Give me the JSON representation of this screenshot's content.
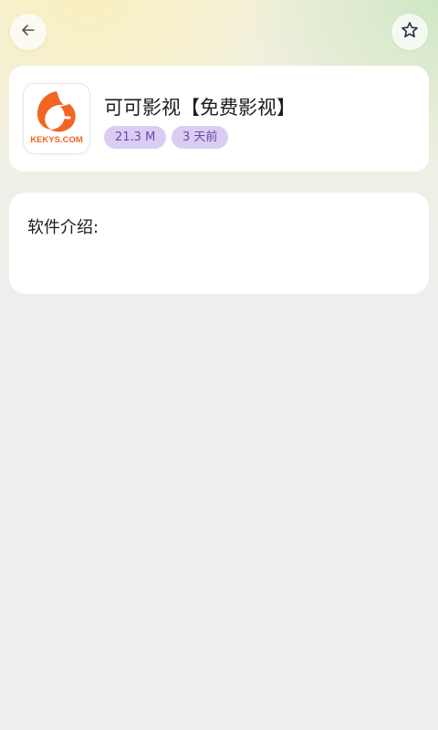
{
  "header": {
    "back_icon": "arrow-left-icon",
    "favorite_icon": "star-outline-icon"
  },
  "app": {
    "name": "可可影视【免费影视】",
    "icon_text": "KEKYS.COM",
    "icon_color": "#f26522",
    "size": "21.3 M",
    "updated": "3 天前"
  },
  "description": {
    "label": "软件介绍:"
  },
  "colors": {
    "chip_bg": "#d9cdf3",
    "chip_text": "#6b4aa8",
    "brand_orange": "#f26522"
  }
}
